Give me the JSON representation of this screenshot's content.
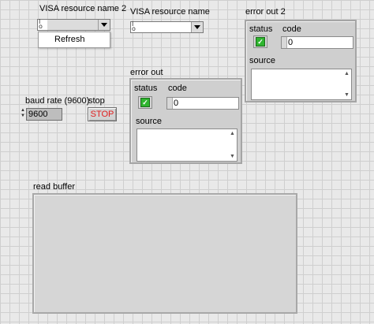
{
  "visa1": {
    "label": "VISA resource name 2",
    "value": "",
    "icon": "visa-resource-icon"
  },
  "visa2": {
    "label": "VISA resource name",
    "value": "",
    "icon": "visa-resource-icon"
  },
  "menu": {
    "items": [
      "Refresh"
    ]
  },
  "error_out": {
    "label": "error out",
    "status_label": "status",
    "code_label": "code",
    "code_value": "0",
    "source_label": "source",
    "source_value": ""
  },
  "error_out2": {
    "label": "error out 2",
    "status_label": "status",
    "code_label": "code",
    "code_value": "0",
    "source_label": "source",
    "source_value": ""
  },
  "baud": {
    "label": "baud rate (9600)",
    "value": "9600"
  },
  "stop": {
    "label": "stop",
    "button_text": "STOP"
  },
  "read_buffer": {
    "label": "read buffer",
    "value": ""
  },
  "colors": {
    "status_ok": "#2fb52f",
    "stop_text": "#e02020",
    "grid": "#cfcfcf"
  }
}
